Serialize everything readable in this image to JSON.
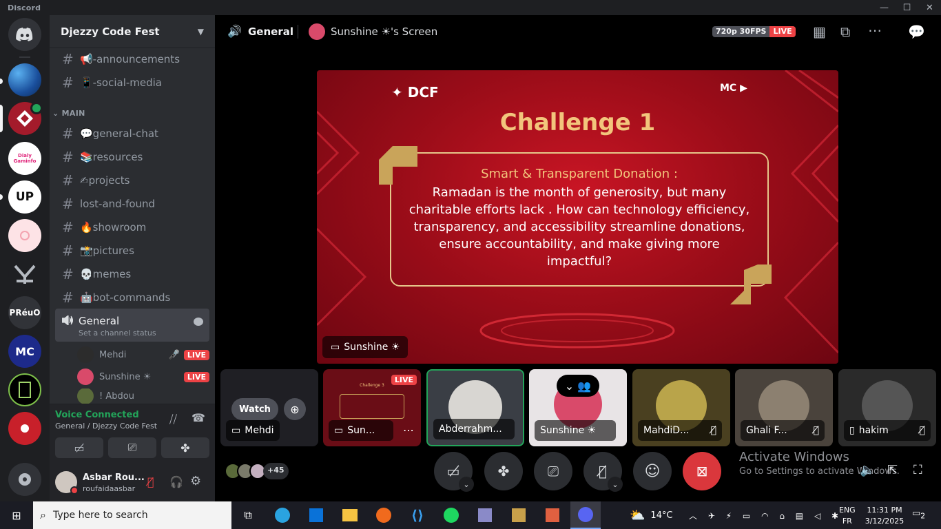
{
  "titlebar": {
    "app": "Discord",
    "minimize": "—",
    "maximize": "☐",
    "close": "✕"
  },
  "guild": {
    "name": "Djezzy Code Fest"
  },
  "channels": {
    "top": [
      {
        "label": "📢-announcements"
      },
      {
        "label": "📱-social-media"
      }
    ],
    "category": "MAIN",
    "main": [
      {
        "label": "💬general-chat"
      },
      {
        "label": "📚resources"
      },
      {
        "label": "✍projects"
      },
      {
        "label": "lost-and-found"
      },
      {
        "label": "🔥showroom"
      },
      {
        "label": "📸pictures"
      },
      {
        "label": "💀memes"
      },
      {
        "label": "🤖bot-commands"
      }
    ]
  },
  "voice_channel": {
    "name": "General",
    "status": "Set a channel status",
    "users": [
      {
        "name": "Mehdi",
        "live": "LIVE"
      },
      {
        "name": "Sunshine ☀",
        "live": "LIVE"
      },
      {
        "name": "! Abdou",
        "live": ""
      }
    ]
  },
  "servers": [
    {
      "label": ""
    },
    {
      "label": ""
    },
    {
      "label": "Dialy Gaminfo"
    },
    {
      "label": "UP"
    },
    {
      "label": ""
    },
    {
      "label": ""
    },
    {
      "label": "PRéuO"
    },
    {
      "label": "MC"
    },
    {
      "label": ""
    },
    {
      "label": ""
    }
  ],
  "voice_connected": {
    "status": "Voice Connected",
    "location": "General / Djezzy Code Fest"
  },
  "user": {
    "display": "Asbar Rou...",
    "username": "roufaidaasbar"
  },
  "stage": {
    "channel": "General",
    "screen": "Sunshine ☀'s Screen",
    "quality": "720p 30FPS",
    "live": "LIVE",
    "slide": {
      "logo": "DCF",
      "title": "Challenge 1",
      "subtitle": "Smart & Transparent Donation :",
      "body": "Ramadan is the month of generosity, but many charitable efforts lack . How can technology efficiency, transparency, and accessibility streamline donations, ensure accountability, and make giving more impactful?"
    },
    "stream_label": "Sunshine ☀",
    "tiles": [
      {
        "name": "Mehdi",
        "action": "Watch"
      },
      {
        "name": "Sun...",
        "badge": "LIVE",
        "thumb": "Challenge 3"
      },
      {
        "name": "Abderrahm..."
      },
      {
        "name": "Sunshine ☀"
      },
      {
        "name": "MahdiD..."
      },
      {
        "name": "Ghali F..."
      },
      {
        "name": "hakim"
      }
    ],
    "extra_count": "+45",
    "activate": {
      "title": "Activate Windows",
      "sub": "Go to Settings to activate Windows."
    }
  },
  "taskbar": {
    "search": "Type here to search",
    "weather": "14°C",
    "lang1": "ENG",
    "lang2": "FR",
    "time": "11:31 PM",
    "date": "3/12/2025",
    "notif": "2"
  },
  "colors": {
    "live": "#ed4245",
    "green": "#23a55a",
    "accent": "#5865f2"
  }
}
